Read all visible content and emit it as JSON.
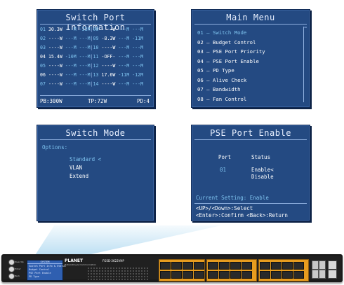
{
  "switch_port_info": {
    "title": "Switch Port Information",
    "rows": [
      [
        "01",
        "30.3W",
        "---M",
        "-33M",
        "08",
        "----W",
        "---M",
        "---M"
      ],
      [
        "02",
        "----W",
        "---M",
        "---M",
        "09",
        "-8.3W",
        "---M",
        "-11M"
      ],
      [
        "03",
        "----W",
        "---M",
        "---M",
        "10",
        "----W",
        "---M",
        "---M"
      ],
      [
        "04",
        "15.4W",
        "-10M",
        "---M",
        "11",
        "-OFF-",
        "---M",
        "---M"
      ],
      [
        "05",
        "----W",
        "---M",
        "---M",
        "12",
        "----W",
        "---M",
        "---M"
      ],
      [
        "06",
        "----W",
        "---M",
        "---M",
        "13",
        "17.6W",
        "-11M",
        "-12M"
      ],
      [
        "07",
        "----W",
        "---M",
        "---M",
        "14",
        "----W",
        "---M",
        "---M"
      ]
    ],
    "footer": {
      "pb": "PB:300W",
      "tp": "TP:72W",
      "pd": "PD:4"
    }
  },
  "main_menu": {
    "title": "Main Menu",
    "items": [
      "01 — Switch Mode",
      "02 — Budget Control",
      "03 — PSE Port Priority",
      "04 — PSE Port Enable",
      "05 — PD Type",
      "06 — Alive Check",
      "07 — Bandwidth",
      "08 — Fan Control"
    ],
    "selected_index": 0
  },
  "switch_mode": {
    "title": "Switch Mode",
    "options_label": "Options:",
    "options": [
      "Standard <",
      "VLAN",
      "Extend"
    ],
    "selected_index": 0
  },
  "pse_port_enable": {
    "title": "PSE Port Enable",
    "col_port": "Port",
    "col_status": "Status",
    "port": "01",
    "status_options": [
      "Enable<",
      "Disable"
    ],
    "current_setting": "Current Setting: Enable",
    "help_line1": "<UP>/<Down>:Select",
    "help_line2": "<Enter>:Confirm <Back>:Return"
  },
  "device": {
    "brand": "PLANET",
    "brand_sub": "Networking & Communication",
    "model": "FGSD-2622VHP",
    "lcd_title": "SYSTEM",
    "lcd_lines": [
      "Switch Port Info & Status",
      "Budget Control",
      "PSE Port Enable",
      "PD Type"
    ],
    "buttons": [
      "Down/Up",
      "Enter",
      "Back"
    ]
  },
  "colors": {
    "panel_bg": "#244a82",
    "highlight": "#7fc4f0",
    "port_block": "#e79c1f"
  }
}
